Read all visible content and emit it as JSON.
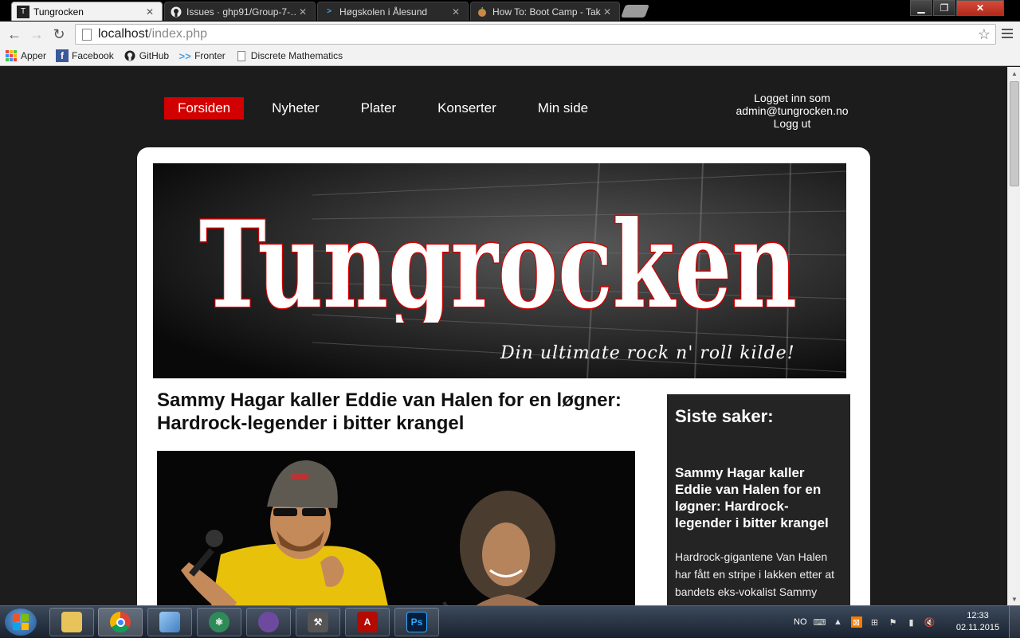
{
  "browser": {
    "tabs": [
      {
        "label": "Tungrocken",
        "icon": "page-logo-icon",
        "active": true
      },
      {
        "label": "Issues · ghp91/Group-7-…",
        "icon": "github-icon",
        "active": false
      },
      {
        "label": "Høgskolen i Ålesund",
        "icon": "fronter-icon",
        "active": false
      },
      {
        "label": "How To: Boot Camp - Tak",
        "icon": "apple-icon",
        "active": false
      }
    ],
    "url_host": "localhost",
    "url_path": "/index.php",
    "bookmarks": [
      {
        "label": "Apper",
        "icon": "apps-grid-icon"
      },
      {
        "label": "Facebook",
        "icon": "facebook-icon"
      },
      {
        "label": "GitHub",
        "icon": "github-icon"
      },
      {
        "label": "Fronter",
        "icon": "fronter-icon"
      },
      {
        "label": "Discrete Mathematics",
        "icon": "page-icon"
      }
    ]
  },
  "site": {
    "nav": [
      {
        "label": "Forsiden",
        "active": true
      },
      {
        "label": "Nyheter",
        "active": false
      },
      {
        "label": "Plater",
        "active": false
      },
      {
        "label": "Konserter",
        "active": false
      },
      {
        "label": "Min side",
        "active": false
      }
    ],
    "login": {
      "line1": "Logget inn som",
      "line2": "admin@tungrocken.no",
      "logout": "Logg ut"
    },
    "banner": {
      "logo_text": "Tungrocken",
      "slogan": "Din ultimate rock n' roll kilde!"
    },
    "article": {
      "title": "Sammy Hagar kaller Eddie van Halen for en løgner: Hardrock-legender i bitter krangel"
    },
    "sidebar": {
      "heading": "Siste saker:",
      "item_title": "Sammy Hagar kaller Eddie van Halen for en løgner: Hardrock-legender i bitter krangel",
      "item_excerpt": "Hardrock-gigantene Van Halen har fått en stripe i lakken etter at bandets eks-vokalist Sammy"
    },
    "colors": {
      "accent": "#d20000",
      "background": "#1c1c1c",
      "sidebar": "#242424"
    }
  },
  "taskbar": {
    "apps": [
      "file-explorer-icon",
      "chrome-icon",
      "virtualbox-icon",
      "atom-icon",
      "github-desktop-icon",
      "tools-icon",
      "acrobat-icon",
      "photoshop-icon"
    ],
    "photoshop_label": "Ps",
    "language": "NO",
    "time": "12:33",
    "date": "02.11.2015"
  }
}
